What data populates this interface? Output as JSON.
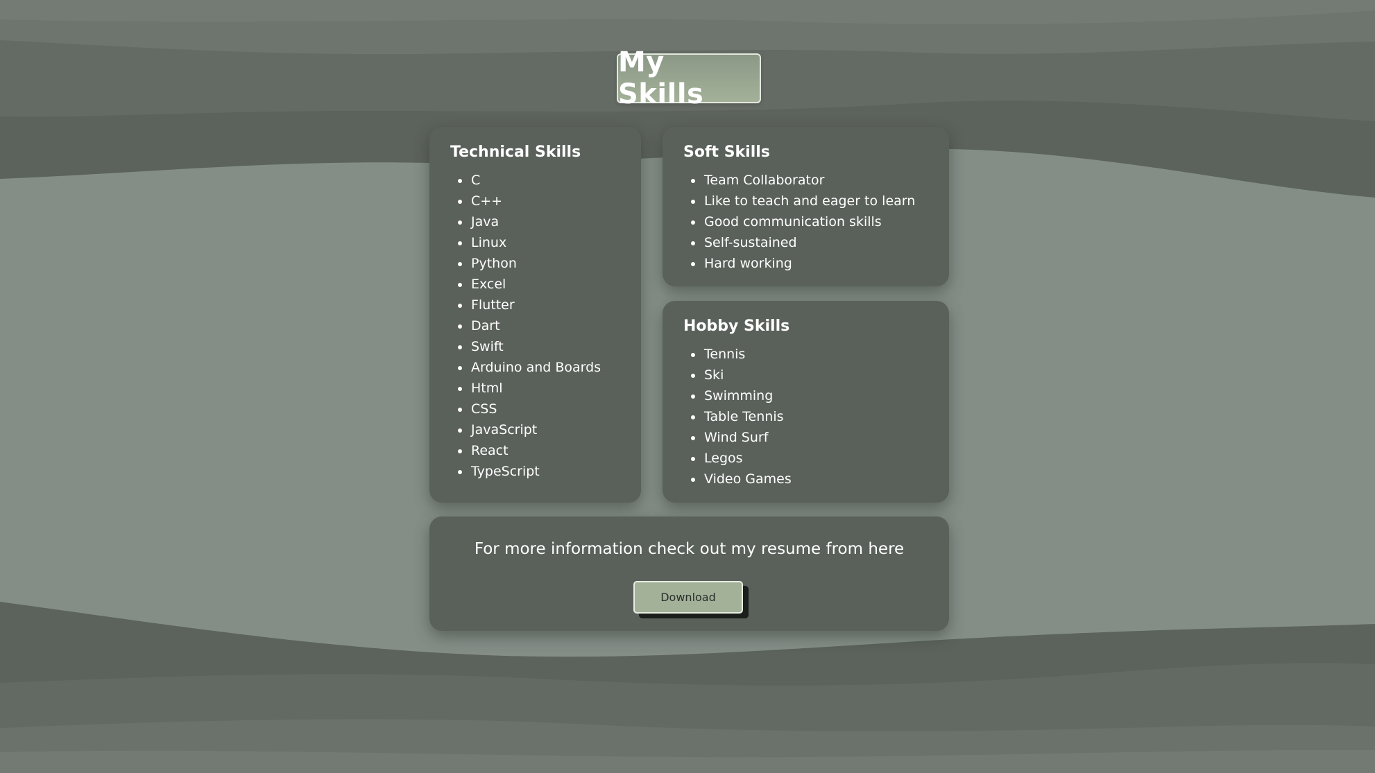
{
  "title": "My Skills",
  "colors": {
    "background": "#848e87",
    "card": "#5a605a",
    "accent": "#a3b199",
    "text": "#ffffff"
  },
  "technical": {
    "heading": "Technical Skills",
    "items": [
      "C",
      "C++",
      "Java",
      "Linux",
      "Python",
      "Excel",
      "Flutter",
      "Dart",
      "Swift",
      "Arduino and Boards",
      "Html",
      "CSS",
      "JavaScript",
      "React",
      "TypeScript"
    ]
  },
  "soft": {
    "heading": "Soft Skills",
    "items": [
      "Team Collaborator",
      "Like to teach and eager to learn",
      "Good communication skills",
      "Self-sustained",
      "Hard working"
    ]
  },
  "hobby": {
    "heading": "Hobby Skills",
    "items": [
      "Tennis",
      "Ski",
      "Swimming",
      "Table Tennis",
      "Wind Surf",
      "Legos",
      "Video Games"
    ]
  },
  "resume": {
    "text": "For more information check out my resume from here",
    "button_label": "Download"
  }
}
